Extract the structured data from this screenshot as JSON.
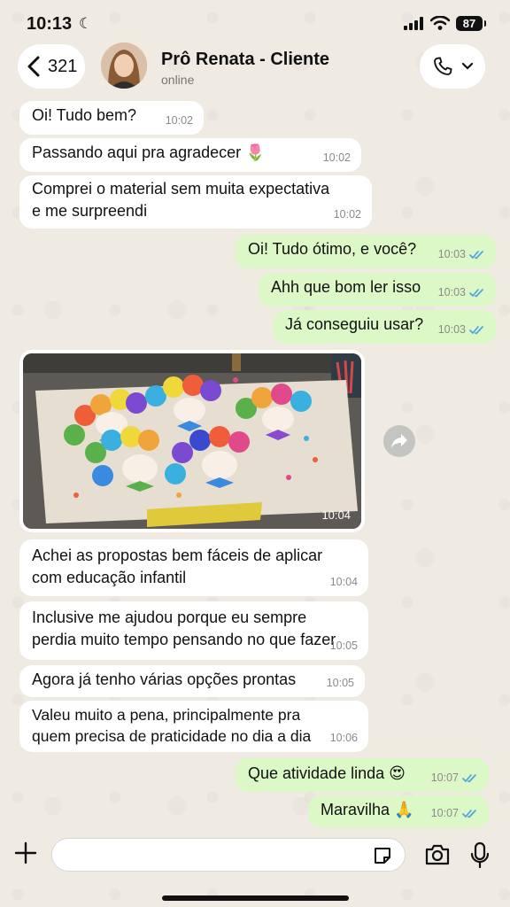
{
  "status_bar": {
    "time": "10:13",
    "battery": "87"
  },
  "header": {
    "back_count": "321",
    "contact_name": "Prô Renata - Cliente",
    "contact_status": "online"
  },
  "messages": [
    {
      "text": "Oi! Tudo bem?",
      "time": "10:02",
      "direction": "in"
    },
    {
      "text": "Passando aqui pra agradecer 🌷",
      "time": "10:02",
      "direction": "in"
    },
    {
      "text": "Comprei o material sem muita expectativa\ne me surpreendi",
      "time": "10:02",
      "direction": "in"
    },
    {
      "text": "Oi! Tudo ótimo, e você?",
      "time": "10:03",
      "direction": "out"
    },
    {
      "text": "Ahh que bom ler isso",
      "time": "10:03",
      "direction": "out"
    },
    {
      "text": "Já conseguiu usar?",
      "time": "10:03",
      "direction": "out"
    },
    {
      "text": "Achei as propostas bem fáceis de aplicar\ncom educação infantil",
      "time": "10:04",
      "direction": "in"
    },
    {
      "text": "Inclusive me ajudou porque eu sempre\nperdia muito tempo pensando no que fazer",
      "time": "10:05",
      "direction": "in"
    },
    {
      "text": "Agora já tenho várias opções prontas",
      "time": "10:05",
      "direction": "in"
    },
    {
      "text": "Valeu muito a pena, principalmente pra\nquem precisa de praticidade no dia a dia",
      "time": "10:06",
      "direction": "in"
    },
    {
      "text": "Que atividade linda 😍",
      "time": "10:07",
      "direction": "out"
    },
    {
      "text": "Maravilha 🙏",
      "time": "10:07",
      "direction": "out"
    }
  ],
  "image_message": {
    "time": "10:04",
    "direction": "in"
  },
  "colors": {
    "incoming": "#ffffff",
    "outgoing": "#dcf8c6",
    "read_check": "#4fa3e0",
    "background": "#efeae2"
  }
}
